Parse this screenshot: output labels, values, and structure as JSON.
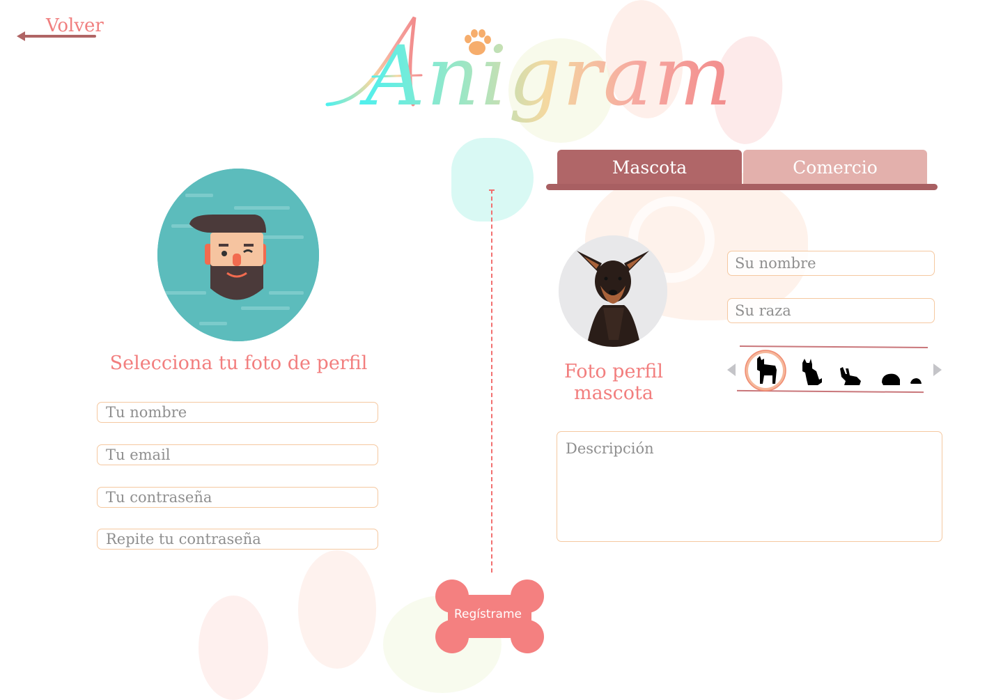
{
  "app": {
    "title": "Anigram"
  },
  "nav": {
    "back_label": "Volver"
  },
  "user": {
    "select_photo_label": "Selecciona tu foto de perfil",
    "fields": {
      "name_placeholder": "Tu nombre",
      "email_placeholder": "Tu email",
      "password_placeholder": "Tu contraseña",
      "repeat_password_placeholder": "Repite tu contraseña"
    }
  },
  "tabs": [
    {
      "label": "Mascota",
      "active": true
    },
    {
      "label": "Comercio",
      "active": false
    }
  ],
  "pet": {
    "photo_label": "Foto perfil mascota",
    "name_placeholder": "Su nombre",
    "breed_placeholder": "Su raza",
    "species_options": [
      "dog-icon",
      "cat-icon",
      "rabbit-icon",
      "hamster-icon",
      "mouse-icon"
    ],
    "selected_species": "dog-icon",
    "description_placeholder": "Descripción"
  },
  "actions": {
    "register_label": "Regístrame"
  },
  "colors": {
    "accent": "#f27e7e",
    "tab_active": "#b06668",
    "tab_inactive": "#e3b0ac",
    "field_border": "#f5c8a0",
    "register_button": "#f48080"
  }
}
